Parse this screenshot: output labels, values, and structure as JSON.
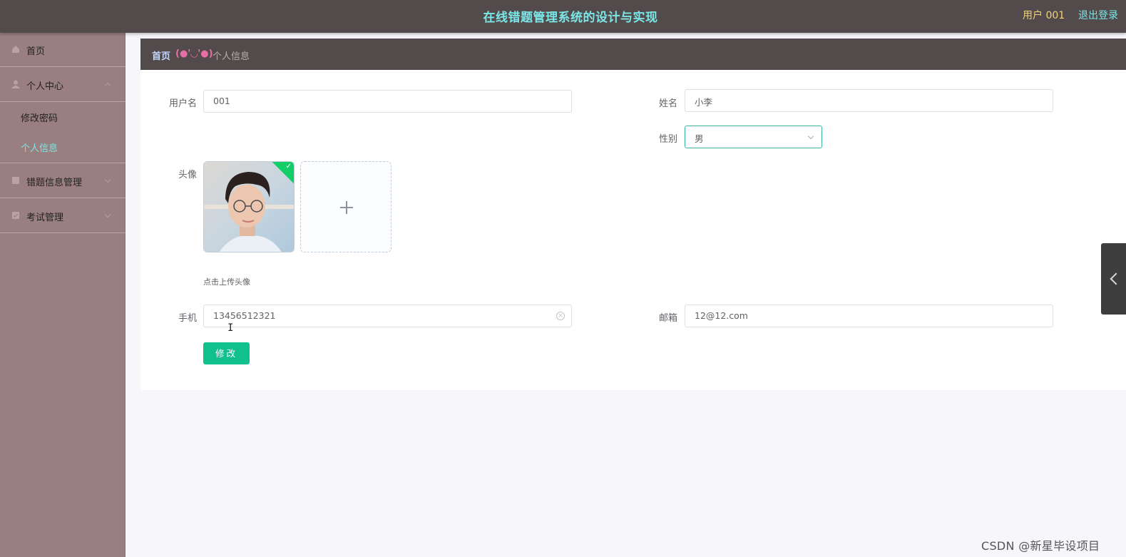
{
  "header": {
    "title": "在线错题管理系统的设计与实现",
    "user": "用户 001",
    "logout": "退出登录"
  },
  "sidebar": {
    "home": "首页",
    "personal_center": "个人中心",
    "change_password": "修改密码",
    "personal_info": "个人信息",
    "wrong_questions": "错题信息管理",
    "exam_management": "考试管理"
  },
  "breadcrumb": {
    "home": "首页",
    "separator": "(●'◡'●)",
    "current": "个人信息"
  },
  "form": {
    "username_label": "用户名",
    "username_value": "001",
    "name_label": "姓名",
    "name_value": "小李",
    "gender_label": "性别",
    "gender_value": "男",
    "avatar_label": "头像",
    "upload_hint": "点击上传头像",
    "phone_label": "手机",
    "phone_value": "13456512321",
    "email_label": "邮箱",
    "email_value": "12@12.com",
    "submit_label": "修改"
  },
  "watermark": "CSDN @新星毕设项目",
  "colors": {
    "header_bg": "#524a4b",
    "title": "#7ae6e6",
    "user": "#f1d27b",
    "sidebar_bg": "#9a7f80",
    "active_menu": "#7ae6e6",
    "button": "#10c18d",
    "breadcrumb_separator": "#e86ea8"
  },
  "icons": {
    "home": "home-icon",
    "user": "user-icon",
    "doc": "document-icon",
    "exam": "exam-icon"
  }
}
